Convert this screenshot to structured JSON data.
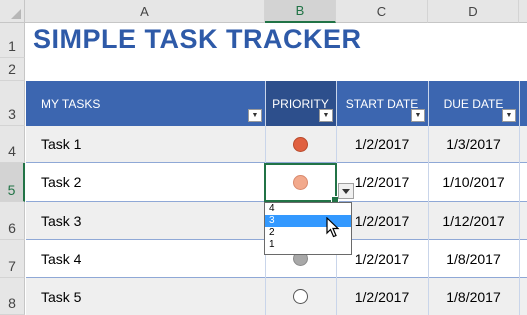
{
  "columns": [
    "A",
    "B",
    "C",
    "D"
  ],
  "rows": [
    "1",
    "2",
    "3",
    "4",
    "5",
    "6",
    "7",
    "8"
  ],
  "sheet_title": "SIMPLE TASK TRACKER",
  "headers": {
    "tasks": "MY TASKS",
    "priority": "PRIORITY",
    "start": "START DATE",
    "due": "DUE DATE"
  },
  "tasks": [
    {
      "name": "Task 1",
      "priority_color": "#e06040",
      "start": "1/2/2017",
      "due": "1/3/2017"
    },
    {
      "name": "Task 2",
      "priority_color": "#f2a98c",
      "start": "1/2/2017",
      "due": "1/10/2017"
    },
    {
      "name": "Task 3",
      "priority_color": "",
      "start": "1/2/2017",
      "due": "1/12/2017"
    },
    {
      "name": "Task 4",
      "priority_color": "#a8a8a8",
      "start": "1/2/2017",
      "due": "1/8/2017"
    },
    {
      "name": "Task 5",
      "priority_color": "#ffffff",
      "start": "1/2/2017",
      "due": "1/8/2017"
    }
  ],
  "dropdown": {
    "options": [
      "4",
      "3",
      "2",
      "1"
    ],
    "highlighted": "3"
  },
  "colors": {
    "header_blue": "#3c66b0",
    "priority_header": "#2d4f8c",
    "title_blue": "#2e5aa8",
    "selection_green": "#217346"
  }
}
